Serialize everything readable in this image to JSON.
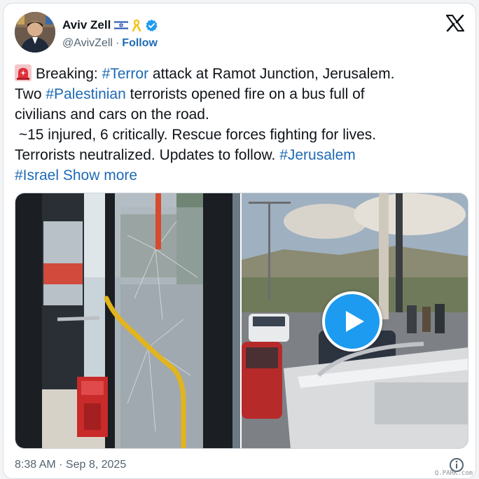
{
  "author": {
    "display_name": "Aviv Zell",
    "handle": "@AvivZell",
    "separator": "·",
    "follow_label": "Follow"
  },
  "tweet": {
    "line1_prefix": "Breaking: ",
    "line1_tag": "#Terror",
    "line1_rest": " attack at Ramot Junction, Jerusalem.",
    "line2_prefix": "Two ",
    "line2_tag": "#Palestinian",
    "line2_rest": " terrorists opened fire on a bus full of",
    "line3": "civilians and cars on the road.",
    "line4": " ~15 injured, 6 critically. Rescue forces fighting for lives.",
    "line5_prefix": "Terrorists neutralized. Updates to follow. ",
    "line5_tag": "#Jerusalem",
    "line6_tag": "#Israel",
    "show_more": "Show more"
  },
  "timestamp": "8:38 AM · Sep 8, 2025",
  "watermark": "Q.PARK.com",
  "colors": {
    "link": "#1d6ab5",
    "verified": "#1d9bf0",
    "play": "#1d9bf0"
  },
  "icons": [
    "israel-flag-icon",
    "yellow-ribbon-icon",
    "verified-badge-icon",
    "x-logo-icon",
    "siren-icon",
    "play-icon",
    "info-icon"
  ]
}
